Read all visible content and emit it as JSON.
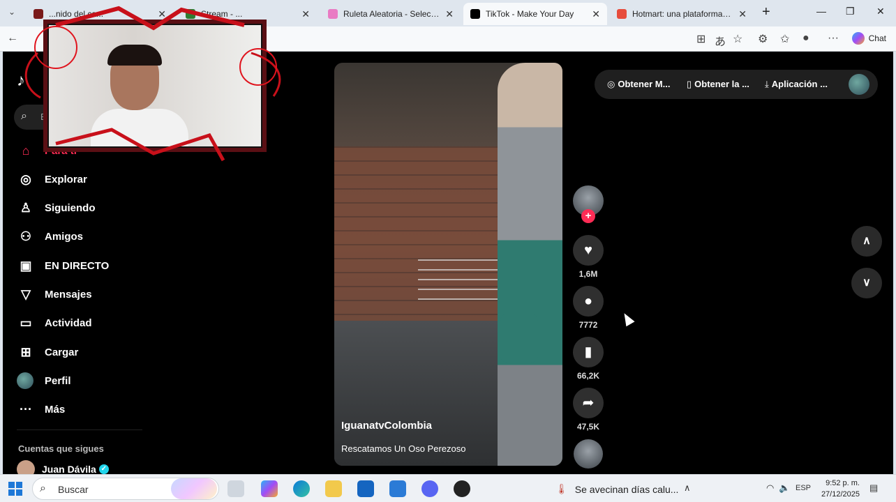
{
  "browser": {
    "tabs": [
      {
        "label": "...nido del ca...",
        "icon_color": "#7a1a1a",
        "active": false
      },
      {
        "label": "Stream - ...",
        "icon_color": "#2e7d32",
        "active": false
      },
      {
        "label": "Ruleta Aleatoria - Selector Pers",
        "icon_color": "#e97bc3",
        "active": false
      },
      {
        "label": "TikTok - Make Your Day",
        "icon_color": "#000000",
        "active": true
      },
      {
        "label": "Hotmart: una plataforma digita",
        "icon_color": "#e74c3c",
        "active": false
      }
    ],
    "new_tab_symbol": "+",
    "window_controls": [
      "—",
      "❐",
      "✕"
    ],
    "chat_label": "Chat"
  },
  "tiktok": {
    "brand_mark": "♪",
    "search_hint": "Bu",
    "nav": [
      {
        "label": "Para ti",
        "icon": "home-icon",
        "glyph": "⌂",
        "active": true
      },
      {
        "label": "Explorar",
        "icon": "compass-icon",
        "glyph": "◎",
        "active": false
      },
      {
        "label": "Siguiendo",
        "icon": "user-follow-icon",
        "glyph": "♙",
        "active": false
      },
      {
        "label": "Amigos",
        "icon": "friends-icon",
        "glyph": "⚇",
        "active": false
      },
      {
        "label": "EN DIRECTO",
        "icon": "live-tv-icon",
        "glyph": "▣",
        "active": false
      },
      {
        "label": "Mensajes",
        "icon": "send-icon",
        "glyph": "▽",
        "active": false
      },
      {
        "label": "Actividad",
        "icon": "activity-icon",
        "glyph": "▭",
        "active": false
      },
      {
        "label": "Cargar",
        "icon": "upload-icon",
        "glyph": "⊞",
        "active": false
      },
      {
        "label": "Perfil",
        "icon": "profile-avatar",
        "glyph": "",
        "active": false
      },
      {
        "label": "Más",
        "icon": "more-icon",
        "glyph": "···",
        "active": false
      }
    ],
    "following_title": "Cuentas que sigues",
    "following": [
      {
        "name": "Juan Dávila",
        "verified": true
      }
    ],
    "video": {
      "author": "IguanatvColombia",
      "description": "Rescatamos Un Oso Perezoso"
    },
    "actions": {
      "likes": "1,6M",
      "comments": "7772",
      "saves": "66,2K",
      "shares": "47,5K"
    },
    "topbar": [
      {
        "label": "Obtener M...",
        "icon": "coin-icon",
        "glyph": "◎"
      },
      {
        "label": "Obtener la ...",
        "icon": "phone-icon",
        "glyph": "▯"
      },
      {
        "label": "Aplicación ...",
        "icon": "download-icon",
        "glyph": "⤓"
      }
    ]
  },
  "taskbar": {
    "search_label": "Buscar",
    "weather_text": "Se avecinan días calu...",
    "language": "ESP",
    "time": "9:52 p. m.",
    "date": "27/12/2025"
  },
  "colors": {
    "accent": "#fe2c55",
    "background": "#000000"
  }
}
